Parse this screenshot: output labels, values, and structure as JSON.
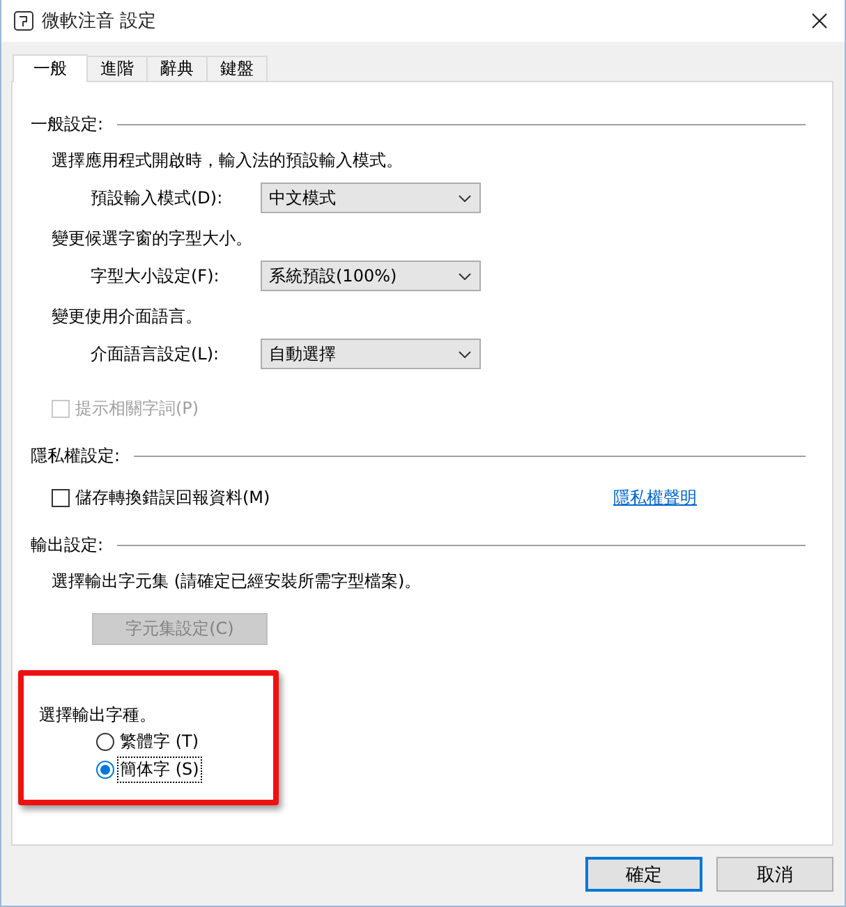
{
  "window": {
    "title": "微軟注音 設定"
  },
  "tabs": [
    {
      "label": "一般",
      "selected": true
    },
    {
      "label": "進階",
      "selected": false
    },
    {
      "label": "辭典",
      "selected": false
    },
    {
      "label": "鍵盤",
      "selected": false
    }
  ],
  "sections": [
    {
      "title": "一般設定:",
      "items": [
        {
          "kind": "text",
          "text": "選擇應用程式開啟時，輸入法的預設輸入模式。"
        },
        {
          "kind": "dropdown",
          "label": "預設輸入模式(D):",
          "value": "中文模式"
        },
        {
          "kind": "text",
          "text": "變更候選字窗的字型大小。"
        },
        {
          "kind": "dropdown",
          "label": "字型大小設定(F):",
          "value": "系統預設(100%)"
        },
        {
          "kind": "text",
          "text": "變更使用介面語言。"
        },
        {
          "kind": "dropdown",
          "label": "介面語言設定(L):",
          "value": "自動選擇"
        },
        {
          "kind": "checkbox",
          "label": "提示相關字詞(P)",
          "checked": false,
          "disabled": true
        }
      ]
    },
    {
      "title": "隱私權設定:",
      "items": [
        {
          "kind": "checkbox",
          "label": "儲存轉換錯誤回報資料(M)",
          "checked": false,
          "disabled": false,
          "link": "隱私權聲明"
        }
      ]
    },
    {
      "title": "輸出設定:",
      "items": [
        {
          "kind": "text",
          "text": "選擇輸出字元集 (請確定已經安裝所需字型檔案)。"
        },
        {
          "kind": "button",
          "label": "字元集設定(C)",
          "disabled": true
        },
        {
          "kind": "radio-group",
          "highlighted": true,
          "text": "選擇輸出字種。",
          "options": [
            {
              "label": "繁體字 (T)",
              "selected": false,
              "focused": false
            },
            {
              "label": "簡体字 (S)",
              "selected": true,
              "focused": true
            }
          ]
        }
      ]
    }
  ],
  "buttons": [
    {
      "label": "確定",
      "default": true
    },
    {
      "label": "取消",
      "default": false
    }
  ]
}
